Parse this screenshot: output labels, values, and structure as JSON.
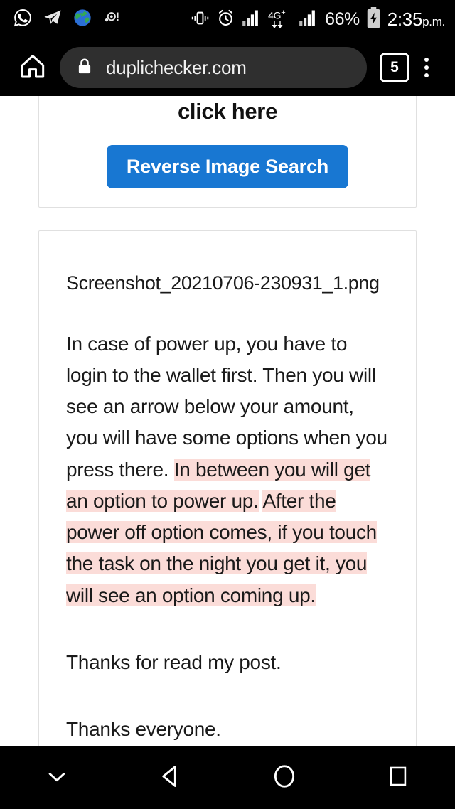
{
  "status_bar": {
    "left_icons": [
      {
        "name": "whatsapp-icon",
        "label": "WhatsApp"
      },
      {
        "name": "telegram-icon",
        "label": "Telegram"
      },
      {
        "name": "globe-icon",
        "label": "Browser"
      },
      {
        "name": "notification-alert-icon",
        "label": "Notification"
      }
    ],
    "right_icons": [
      {
        "name": "vibrate-icon",
        "label": "Vibrate"
      },
      {
        "name": "alarm-icon",
        "label": "Alarm"
      },
      {
        "name": "signal-bars-icon",
        "label": "Signal"
      },
      {
        "name": "network-type-icon",
        "label": "4G+"
      },
      {
        "name": "signal-bars-2-icon",
        "label": "Signal 2"
      },
      {
        "name": "battery-charging-icon",
        "label": "Battery charging"
      }
    ],
    "network_type": "4G",
    "network_plus": "+",
    "battery_percent": "66%",
    "time": "2:35",
    "ampm": "p.m."
  },
  "toolbar": {
    "home_icon": "home-icon",
    "lock_icon": "lock-icon",
    "url": "duplichecker.com",
    "tab_count": "5",
    "menu_icon": "overflow-menu-icon"
  },
  "promo_card": {
    "heading": "To check plagiarism in photos click here",
    "button_label": "Reverse Image Search",
    "button_color": "#1877d2"
  },
  "document_card": {
    "filename": "Screenshot_20210706-230931_1.png",
    "highlight_color": "#fbdcd8",
    "paragraphs": [
      {
        "segments": [
          {
            "text": "In case of power up, you have to login to the wallet first. Then you will see an arrow below your amount, you will have some options when you press there. ",
            "highlight": false
          },
          {
            "text": "In between you will get an option to power up.",
            "highlight": true
          },
          {
            "text": " ",
            "highlight": false
          },
          {
            "text": "After the power off option comes, if you touch the task on the night you get it, you will see an option coming up.",
            "highlight": true
          }
        ]
      },
      {
        "segments": [
          {
            "text": "Thanks for read my post.",
            "highlight": false
          }
        ]
      },
      {
        "segments": [
          {
            "text": "Thanks everyone.",
            "highlight": false
          }
        ]
      }
    ]
  },
  "navbar": {
    "buttons": [
      {
        "name": "hide-keyboard-icon",
        "label": "Hide"
      },
      {
        "name": "back-icon",
        "label": "Back"
      },
      {
        "name": "home-circle-icon",
        "label": "Home"
      },
      {
        "name": "recents-icon",
        "label": "Recents"
      }
    ]
  }
}
